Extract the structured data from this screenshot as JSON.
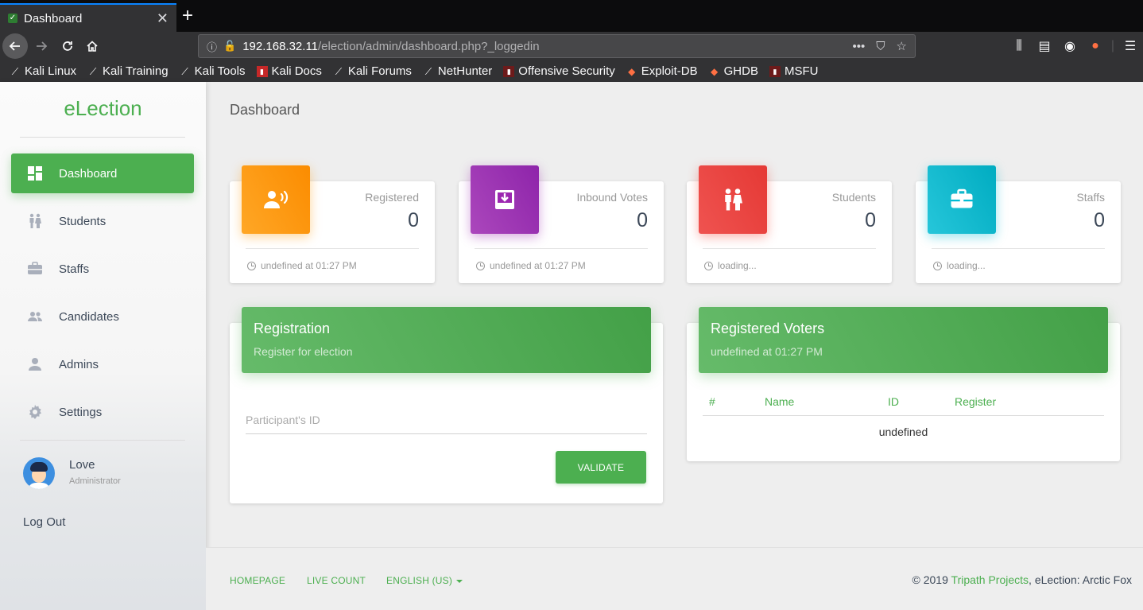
{
  "browser": {
    "tab_title": "Dashboard",
    "close_glyph": "✕",
    "new_tab_glyph": "+",
    "url_host": "192.168.32.11",
    "url_path": "/election/admin/dashboard.php?_loggedin",
    "url_actions_glyph": "•••",
    "bookmarks": [
      {
        "label": "Kali Linux"
      },
      {
        "label": "Kali Training"
      },
      {
        "label": "Kali Tools"
      },
      {
        "label": "Kali Docs"
      },
      {
        "label": "Kali Forums"
      },
      {
        "label": "NetHunter"
      },
      {
        "label": "Offensive Security"
      },
      {
        "label": "Exploit-DB"
      },
      {
        "label": "GHDB"
      },
      {
        "label": "MSFU"
      }
    ]
  },
  "sidebar": {
    "brand": "eLection",
    "items": [
      {
        "label": "Dashboard",
        "icon": "dashboard-icon",
        "active": true
      },
      {
        "label": "Students",
        "icon": "students-icon"
      },
      {
        "label": "Staffs",
        "icon": "briefcase-icon"
      },
      {
        "label": "Candidates",
        "icon": "people-icon"
      },
      {
        "label": "Admins",
        "icon": "person-icon"
      },
      {
        "label": "Settings",
        "icon": "gear-icon"
      }
    ],
    "user": {
      "name": "Love",
      "role": "Administrator"
    },
    "logout": "Log Out"
  },
  "main": {
    "page_title": "Dashboard",
    "stats": [
      {
        "label": "Registered",
        "value": "0",
        "footer": "undefined at 01:27 PM",
        "icon": "broadcast-icon",
        "color": "#ff9800"
      },
      {
        "label": "Inbound Votes",
        "value": "0",
        "footer": "undefined at 01:27 PM",
        "icon": "inbox-icon",
        "color": "#9c27b0"
      },
      {
        "label": "Students",
        "value": "0",
        "footer": "loading...",
        "icon": "students-icon",
        "color": "#e53935"
      },
      {
        "label": "Staffs",
        "value": "0",
        "footer": "loading...",
        "icon": "briefcase-icon",
        "color": "#00bcd4"
      }
    ],
    "registration": {
      "title": "Registration",
      "subtitle": "Register for election",
      "placeholder": "Participant's ID",
      "button": "VALIDATE"
    },
    "voters": {
      "title": "Registered Voters",
      "subtitle": "undefined at 01:27 PM",
      "columns": [
        "#",
        "Name",
        "ID",
        "Register"
      ],
      "empty_text": "undefined"
    }
  },
  "footer": {
    "links": [
      "HOMEPAGE",
      "LIVE COUNT",
      "ENGLISH (US)"
    ],
    "copyright_prefix": "© 2019 ",
    "copyright_link": "Tripath Projects",
    "copyright_suffix": ", eLection: Arctic Fox"
  },
  "colors": {
    "accent": "#4caf50",
    "orange": "#ff9800",
    "purple": "#9c27b0",
    "red": "#e53935",
    "cyan": "#00bcd4"
  }
}
